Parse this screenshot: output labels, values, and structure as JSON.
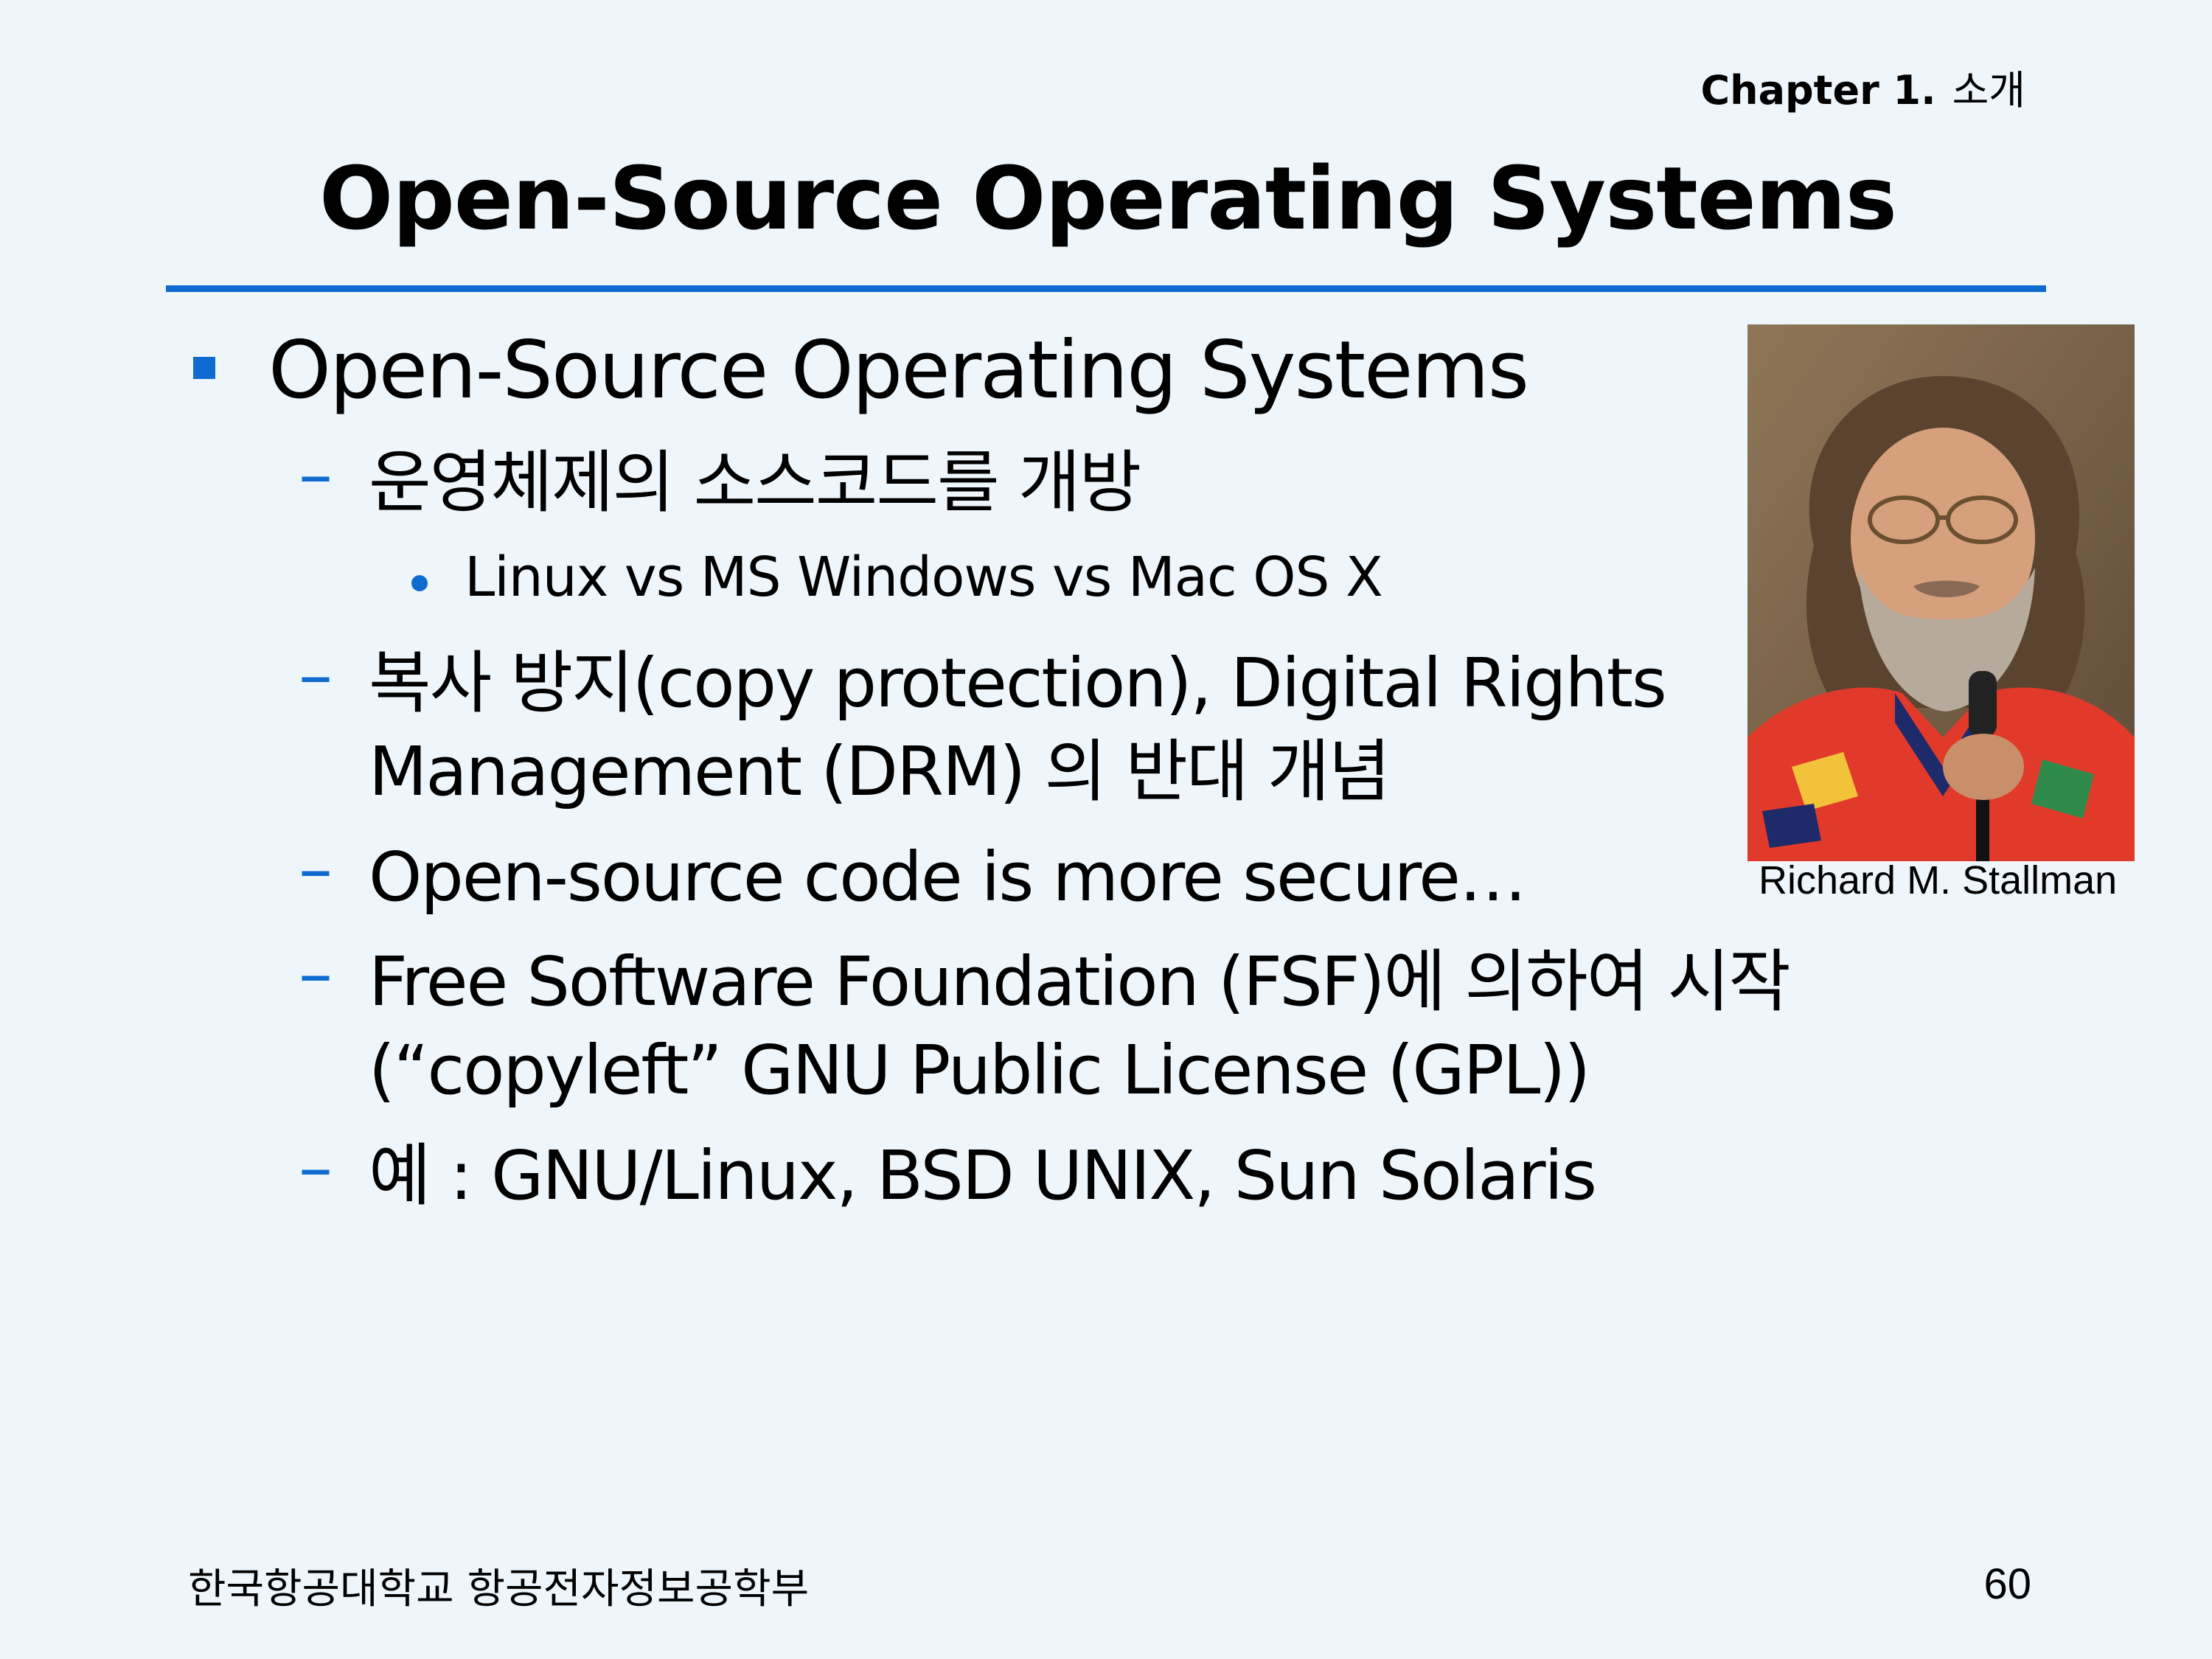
{
  "header": {
    "chapter_label": "Chapter 1.",
    "chapter_name": "소개"
  },
  "title": "Open-Source Operating Systems",
  "content": {
    "level1": "Open-Source Operating Systems",
    "items": [
      {
        "text": "운영체제의 소스코드를 개방"
      },
      {
        "text": "Linux vs MS Windows vs Mac OS X"
      },
      {
        "line1": "복사 방지(copy protection), Digital Rights",
        "line2": "Management (DRM) 의 반대 개념"
      },
      {
        "text": "Open-source code is more secure…"
      },
      {
        "line1": "Free Software Foundation (FSF)에 의하여 시작",
        "line2": "(“copyleft” GNU Public License (GPL))"
      },
      {
        "text": "예 : GNU/Linux, BSD UNIX, Sun Solaris"
      }
    ],
    "dash_glyph": "–"
  },
  "photo": {
    "caption": "Richard M. Stallman"
  },
  "footer": {
    "left": "한국항공대학교 항공전자정보공학부",
    "page_number": "60"
  },
  "colors": {
    "accent": "#0f6bd0",
    "background": "#eef6fb"
  }
}
